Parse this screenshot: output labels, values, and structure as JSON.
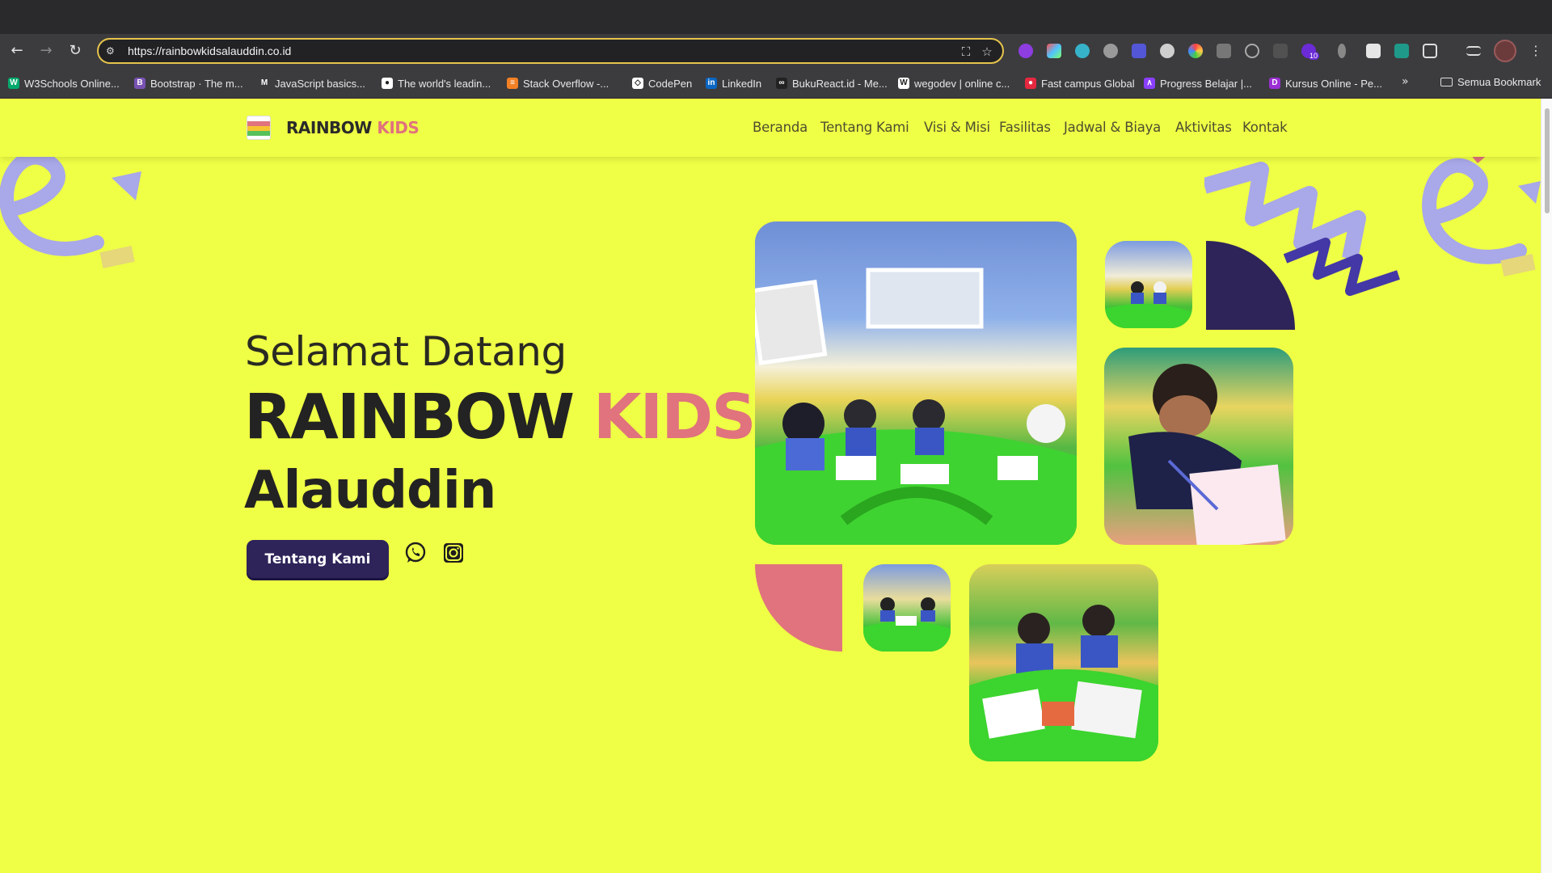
{
  "browser": {
    "url": "https://rainbowkidsalauddin.co.id",
    "extension_badge": "10",
    "bookmarks": [
      {
        "label": "W3Schools Online...",
        "icon": "w3schools-icon",
        "color": "#04aa6d",
        "glyph": "W"
      },
      {
        "label": "Bootstrap · The m...",
        "icon": "bootstrap-icon",
        "color": "#7952b3",
        "glyph": "B"
      },
      {
        "label": "JavaScript basics...",
        "icon": "mdn-icon",
        "color": "#3c3c3f",
        "glyph": "M"
      },
      {
        "label": "The world's leadin...",
        "icon": "github-icon",
        "color": "#ffffff",
        "glyph": "●"
      },
      {
        "label": "Stack Overflow -...",
        "icon": "stackoverflow-icon",
        "color": "#f48024",
        "glyph": "≡"
      },
      {
        "label": "CodePen",
        "icon": "codepen-icon",
        "color": "#ffffff",
        "glyph": "◇"
      },
      {
        "label": "LinkedIn",
        "icon": "linkedin-icon",
        "color": "#0a66c2",
        "glyph": "in"
      },
      {
        "label": "BukuReact.id - Me...",
        "icon": "bukureact-icon",
        "color": "#222222",
        "glyph": "∞"
      },
      {
        "label": "wegodev | online c...",
        "icon": "wegodev-icon",
        "color": "#ffffff",
        "glyph": "W"
      },
      {
        "label": "Fast campus Global",
        "icon": "fastcampus-icon",
        "color": "#e5283f",
        "glyph": "●"
      },
      {
        "label": "Progress Belajar |...",
        "icon": "progress-icon",
        "color": "#8a3ffc",
        "glyph": "∧"
      },
      {
        "label": "Kursus Online - Pe...",
        "icon": "kursus-icon",
        "color": "#9b2fd4",
        "glyph": "D"
      }
    ],
    "all_bookmarks_label": "Semua Bookmark"
  },
  "header": {
    "brand_main": "RAINBOW",
    "brand_accent": "KIDS",
    "nav": [
      "Beranda",
      "Tentang Kami",
      "Visi & Misi",
      "Fasilitas",
      "Jadwal & Biaya",
      "Aktivitas",
      "Kontak"
    ]
  },
  "hero": {
    "greeting": "Selamat Datang",
    "title_main": "RAINBOW",
    "title_accent": "KIDS",
    "subtitle": "Alauddin",
    "cta_label": "Tentang Kami",
    "social_icons": [
      "whatsapp-icon",
      "instagram-icon"
    ]
  },
  "colors": {
    "page_bg": "#efff45",
    "accent_pink": "#e0737d",
    "navy": "#2e2459",
    "deco_purple": "#a9a8e8"
  }
}
